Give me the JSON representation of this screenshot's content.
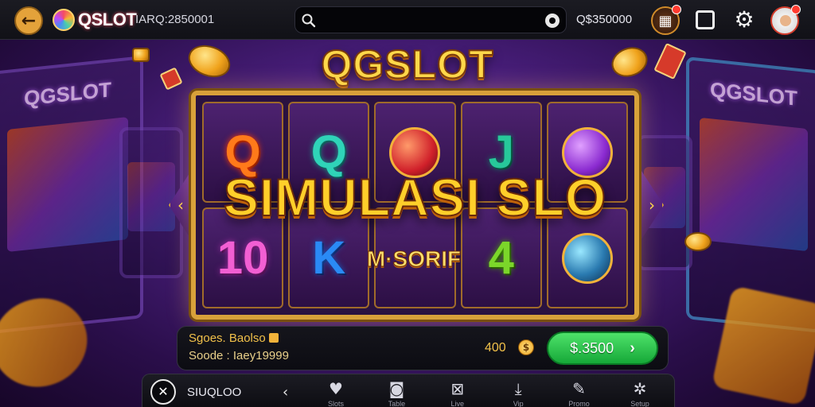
{
  "topbar": {
    "back_label": "←",
    "logo_text": "QSLOT",
    "account_id": "IARQ:2850001",
    "search_placeholder": "",
    "balance": "Q$350000"
  },
  "title": "QGSLOT",
  "banner": {
    "main": "SIMULASI SLO",
    "sub": "M·SORIF"
  },
  "background": {
    "left_cabinet_label": "QGSLOT",
    "right_cabinet_label": "QGSLOT"
  },
  "reels": {
    "row1": [
      "Q",
      "Q",
      "",
      "J",
      ""
    ],
    "row2": [
      "10",
      "K",
      "",
      "4",
      ""
    ]
  },
  "info": {
    "line1": "Sgoes. Baolso",
    "line2": "Soode : Iaey19999",
    "bet": "400",
    "bet_coin_symbol": "$",
    "spin_label": "$.3500",
    "spin_chevron": "›"
  },
  "bottom_nav": {
    "brand_label": "SIUQLOO",
    "collapse": "‹",
    "items": [
      {
        "icon": "heart-icon",
        "glyph": "♥",
        "label": "Slots"
      },
      {
        "icon": "gamepad-icon",
        "glyph": "◙",
        "label": "Table"
      },
      {
        "icon": "gift-icon",
        "glyph": "⊠",
        "label": "Live"
      },
      {
        "icon": "download-icon",
        "glyph": "⤓",
        "label": "Vip"
      },
      {
        "icon": "pencil-icon",
        "glyph": "✎",
        "label": "Promo"
      },
      {
        "icon": "gear-icon",
        "glyph": "✲",
        "label": "Setup"
      }
    ]
  },
  "colors": {
    "accent_gold": "#ffd84a",
    "spin_green": "#16a838",
    "bg_purple": "#4a1f7e"
  }
}
